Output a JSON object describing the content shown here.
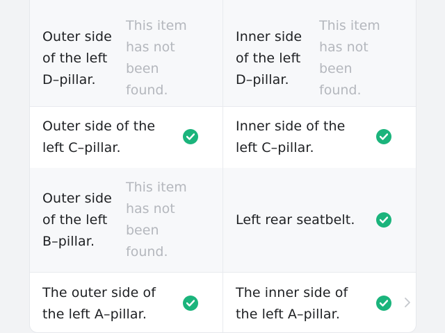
{
  "inspection_grid": {
    "rows": [
      {
        "left": {
          "label": "Outer side of the left D–pillar.",
          "status": "This item has not been found.",
          "found": false
        },
        "right": {
          "label": "Inner side of the left D–pillar.",
          "status": "This item has not been found.",
          "found": false
        }
      },
      {
        "left": {
          "label": "Outer side of the left C–pillar.",
          "status": "found",
          "found": true
        },
        "right": {
          "label": "Inner side of the left C–pillar.",
          "status": "found",
          "found": true
        }
      },
      {
        "left": {
          "label": "Outer side of the left B–pillar.",
          "status": "This item has not been found.",
          "found": false
        },
        "right": {
          "label": "Left rear seatbelt.",
          "status": "found",
          "found": true
        }
      },
      {
        "left": {
          "label": "The outer side of the left A–pillar.",
          "status": "found",
          "found": true
        },
        "right": {
          "label": "The inner side of the left A–pillar.",
          "status": "found",
          "found": true
        }
      }
    ]
  },
  "icons": {
    "found": "check-circle-icon",
    "next": "chevron-right-icon"
  },
  "colors": {
    "check": "#1bb47c",
    "not_found_text": "#b4b7bd",
    "label_text": "#1d1f22",
    "shaded_row": "#f7f8fa"
  }
}
